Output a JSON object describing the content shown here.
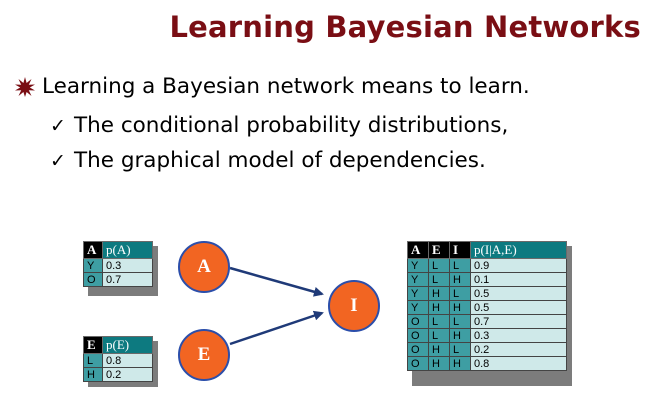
{
  "title": "Learning Bayesian Networks",
  "bullet": {
    "icon": "burst-bullet-icon",
    "text": "Learning a Bayesian network means to learn."
  },
  "sub_bullets": [
    {
      "icon": "checkmark-icon",
      "glyph": "✓",
      "text": "The conditional probability distributions,"
    },
    {
      "icon": "checkmark-icon",
      "glyph": "✓",
      "text": "The graphical model of dependencies."
    }
  ],
  "colors": {
    "title": "#7a0e14",
    "node_fill": "#f26522",
    "node_border": "#2b4eaa",
    "arrow": "#1f3a78",
    "table_key_cell": "#3e9ea3",
    "table_value_cell": "#cfe9e9",
    "table_prob_header": "#0d7a80"
  },
  "nodes": [
    {
      "id": "A",
      "label": "A"
    },
    {
      "id": "E",
      "label": "E"
    },
    {
      "id": "I",
      "label": "I"
    }
  ],
  "tables": {
    "pA": {
      "headers": [
        "A",
        "p(A)"
      ],
      "rows": [
        [
          "Y",
          "0.3"
        ],
        [
          "O",
          "0.7"
        ]
      ]
    },
    "pE": {
      "headers": [
        "E",
        "p(E)"
      ],
      "rows": [
        [
          "L",
          "0.8"
        ],
        [
          "H",
          "0.2"
        ]
      ]
    },
    "pI": {
      "headers": [
        "A",
        "E",
        "I",
        "p(I|A,E)"
      ],
      "rows": [
        [
          "Y",
          "L",
          "L",
          "0.9"
        ],
        [
          "Y",
          "L",
          "H",
          "0.1"
        ],
        [
          "Y",
          "H",
          "L",
          "0.5"
        ],
        [
          "Y",
          "H",
          "H",
          "0.5"
        ],
        [
          "O",
          "L",
          "L",
          "0.7"
        ],
        [
          "O",
          "L",
          "H",
          "0.3"
        ],
        [
          "O",
          "H",
          "L",
          "0.2"
        ],
        [
          "O",
          "H",
          "H",
          "0.8"
        ]
      ]
    }
  }
}
